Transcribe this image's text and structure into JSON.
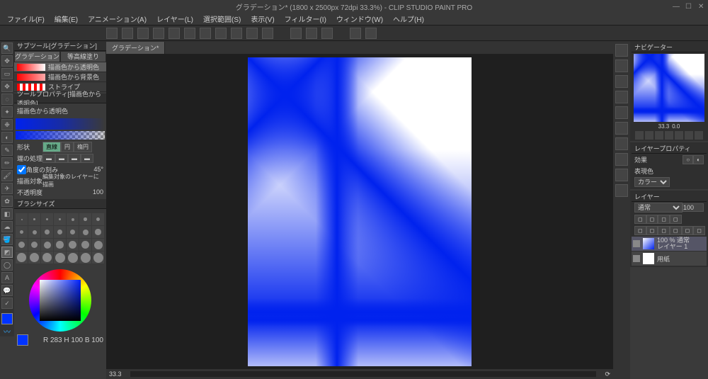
{
  "titlebar": {
    "title": "グラデーション* (1800 x 2500px 72dpi 33.3%) - CLIP STUDIO PAINT PRO"
  },
  "menu": {
    "file": "ファイル(F)",
    "edit": "編集(E)",
    "animation": "アニメーション(A)",
    "layer": "レイヤー(L)",
    "select": "選択範囲(S)",
    "view": "表示(V)",
    "filter": "フィルター(I)",
    "window": "ウィンドウ(W)",
    "help": "ヘルプ(H)"
  },
  "subtool": {
    "header": "サブツール[グラデーション]",
    "tab1": "グラデーション",
    "tab2": "等高線塗り",
    "presets": [
      {
        "name": "描画色から透明色"
      },
      {
        "name": "描画色から背景色"
      },
      {
        "name": "ストライプ"
      }
    ]
  },
  "toolprop": {
    "header": "ツールプロパティ[描画色から透明色]",
    "preset_name": "描画色から透明色",
    "shape_label": "形状",
    "shape_linear": "直線",
    "shape_circle": "円",
    "shape_ellipse": "楕円",
    "edge_label": "端の処理",
    "angle_label": "角度の刻み",
    "angle_value": "45°",
    "target_label": "描画対象",
    "target_value": "編集対象のレイヤーに描画",
    "opacity_label": "不透明度",
    "opacity_value": "100"
  },
  "brush": {
    "header": "ブラシサイズ"
  },
  "color": {
    "readout": "R 283 H 100 B 100"
  },
  "doc": {
    "tab": "グラデーション*"
  },
  "status": {
    "zoom": "33.3"
  },
  "nav": {
    "header": "ナビゲーター",
    "zoom": "33.3",
    "rot": "0.0"
  },
  "layerprop": {
    "header": "レイヤープロパティ",
    "effect": "効果",
    "expr_label": "表現色",
    "expr_value": "カラー"
  },
  "layer": {
    "header": "レイヤー",
    "blend": "通常",
    "opacity": "100",
    "layer1_info": "100 % 通常",
    "layer1_name": "レイヤー 1",
    "paper": "用紙"
  }
}
